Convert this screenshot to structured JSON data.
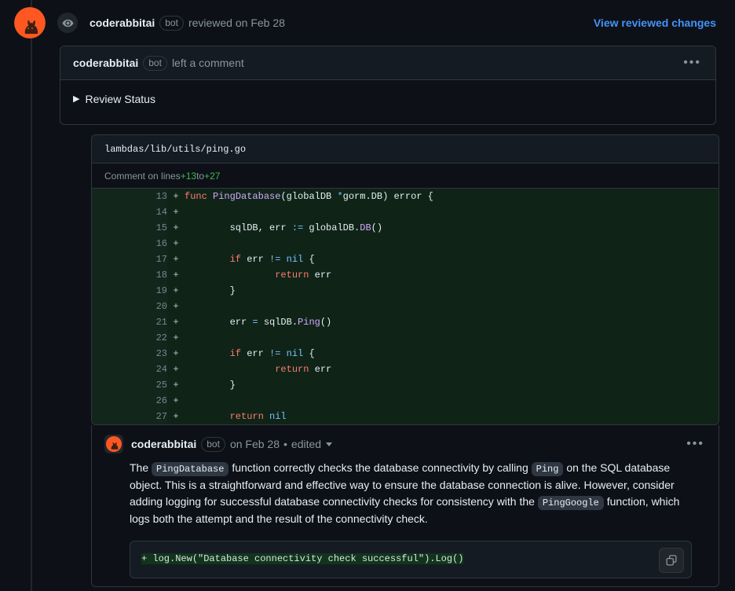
{
  "review_header": {
    "avatar_icon": "coderabbit-avatar",
    "eye_icon": "eye-icon",
    "user": "coderabbitai",
    "bot_tag": "bot",
    "action_text": "reviewed on Feb 28",
    "view_changes_link": "View reviewed changes",
    "link_color": "#4493f8"
  },
  "comment_card": {
    "user": "coderabbitai",
    "bot_tag": "bot",
    "action_text": "left a comment",
    "menu_icon": "kebab-menu-icon",
    "menu_label": "•••",
    "disclosure_marker": "▶",
    "disclosure_label": "Review Status"
  },
  "file_card": {
    "filename": "lambdas/lib/utils/ping.go",
    "comment_on_prefix": "Comment on lines ",
    "comment_on_start": "+13",
    "comment_on_middle": " to ",
    "comment_on_end": "+27",
    "addition_color": "#3fb950",
    "diff_lines": [
      {
        "num": "13",
        "marker": "+",
        "tokens": [
          {
            "t": "func ",
            "c": "k"
          },
          {
            "t": "PingDatabase",
            "c": "fn"
          },
          {
            "t": "(globalDB ",
            "c": ""
          },
          {
            "t": "*",
            "c": "op"
          },
          {
            "t": "gorm.DB) error {",
            "c": ""
          }
        ]
      },
      {
        "num": "14",
        "marker": "+",
        "tokens": [
          {
            "t": "",
            "c": ""
          }
        ]
      },
      {
        "num": "15",
        "marker": "+",
        "tokens": [
          {
            "t": "        sqlDB, err ",
            "c": ""
          },
          {
            "t": ":=",
            "c": "op"
          },
          {
            "t": " globalDB.",
            "c": ""
          },
          {
            "t": "DB",
            "c": "fn"
          },
          {
            "t": "()",
            "c": ""
          }
        ]
      },
      {
        "num": "16",
        "marker": "+",
        "tokens": [
          {
            "t": "",
            "c": ""
          }
        ]
      },
      {
        "num": "17",
        "marker": "+",
        "tokens": [
          {
            "t": "        ",
            "c": ""
          },
          {
            "t": "if",
            "c": "k"
          },
          {
            "t": " err ",
            "c": ""
          },
          {
            "t": "!=",
            "c": "op"
          },
          {
            "t": " ",
            "c": ""
          },
          {
            "t": "nil",
            "c": "cn"
          },
          {
            "t": " {",
            "c": ""
          }
        ]
      },
      {
        "num": "18",
        "marker": "+",
        "tokens": [
          {
            "t": "                ",
            "c": ""
          },
          {
            "t": "return",
            "c": "k"
          },
          {
            "t": " err",
            "c": ""
          }
        ]
      },
      {
        "num": "19",
        "marker": "+",
        "tokens": [
          {
            "t": "        }",
            "c": ""
          }
        ]
      },
      {
        "num": "20",
        "marker": "+",
        "tokens": [
          {
            "t": "",
            "c": ""
          }
        ]
      },
      {
        "num": "21",
        "marker": "+",
        "tokens": [
          {
            "t": "        err ",
            "c": ""
          },
          {
            "t": "=",
            "c": "op"
          },
          {
            "t": " sqlDB.",
            "c": ""
          },
          {
            "t": "Ping",
            "c": "fn"
          },
          {
            "t": "()",
            "c": ""
          }
        ]
      },
      {
        "num": "22",
        "marker": "+",
        "tokens": [
          {
            "t": "",
            "c": ""
          }
        ]
      },
      {
        "num": "23",
        "marker": "+",
        "tokens": [
          {
            "t": "        ",
            "c": ""
          },
          {
            "t": "if",
            "c": "k"
          },
          {
            "t": " err ",
            "c": ""
          },
          {
            "t": "!=",
            "c": "op"
          },
          {
            "t": " ",
            "c": ""
          },
          {
            "t": "nil",
            "c": "cn"
          },
          {
            "t": " {",
            "c": ""
          }
        ]
      },
      {
        "num": "24",
        "marker": "+",
        "tokens": [
          {
            "t": "                ",
            "c": ""
          },
          {
            "t": "return",
            "c": "k"
          },
          {
            "t": " err",
            "c": ""
          }
        ]
      },
      {
        "num": "25",
        "marker": "+",
        "tokens": [
          {
            "t": "        }",
            "c": ""
          }
        ]
      },
      {
        "num": "26",
        "marker": "+",
        "tokens": [
          {
            "t": "",
            "c": ""
          }
        ]
      },
      {
        "num": "27",
        "marker": "+",
        "tokens": [
          {
            "t": "        ",
            "c": ""
          },
          {
            "t": "return",
            "c": "k"
          },
          {
            "t": " ",
            "c": ""
          },
          {
            "t": "nil",
            "c": "cn"
          }
        ]
      }
    ]
  },
  "reply": {
    "avatar_icon": "coderabbit-avatar",
    "user": "coderabbitai",
    "bot_tag": "bot",
    "timestamp": "on Feb 28",
    "separator": "•",
    "edited_label": "edited",
    "caret_icon": "chevron-down-icon",
    "menu_icon": "kebab-menu-icon",
    "menu_label": "•••",
    "body": {
      "part1": "The ",
      "code1": "PingDatabase",
      "part2": " function correctly checks the database connectivity by calling ",
      "code2": "Ping",
      "part3": " on the SQL database object. This is a straightforward and effective way to ensure the database connection is alive. However, consider adding logging for successful database connectivity checks for consistency with the ",
      "code3": "PingGoogle",
      "part4": " function, which logs both the attempt and the result of the connectivity check."
    },
    "suggestion": {
      "marker": "+ ",
      "code": "log.New(\"Database connectivity check successful\").Log()",
      "copy_icon": "copy-icon"
    }
  }
}
